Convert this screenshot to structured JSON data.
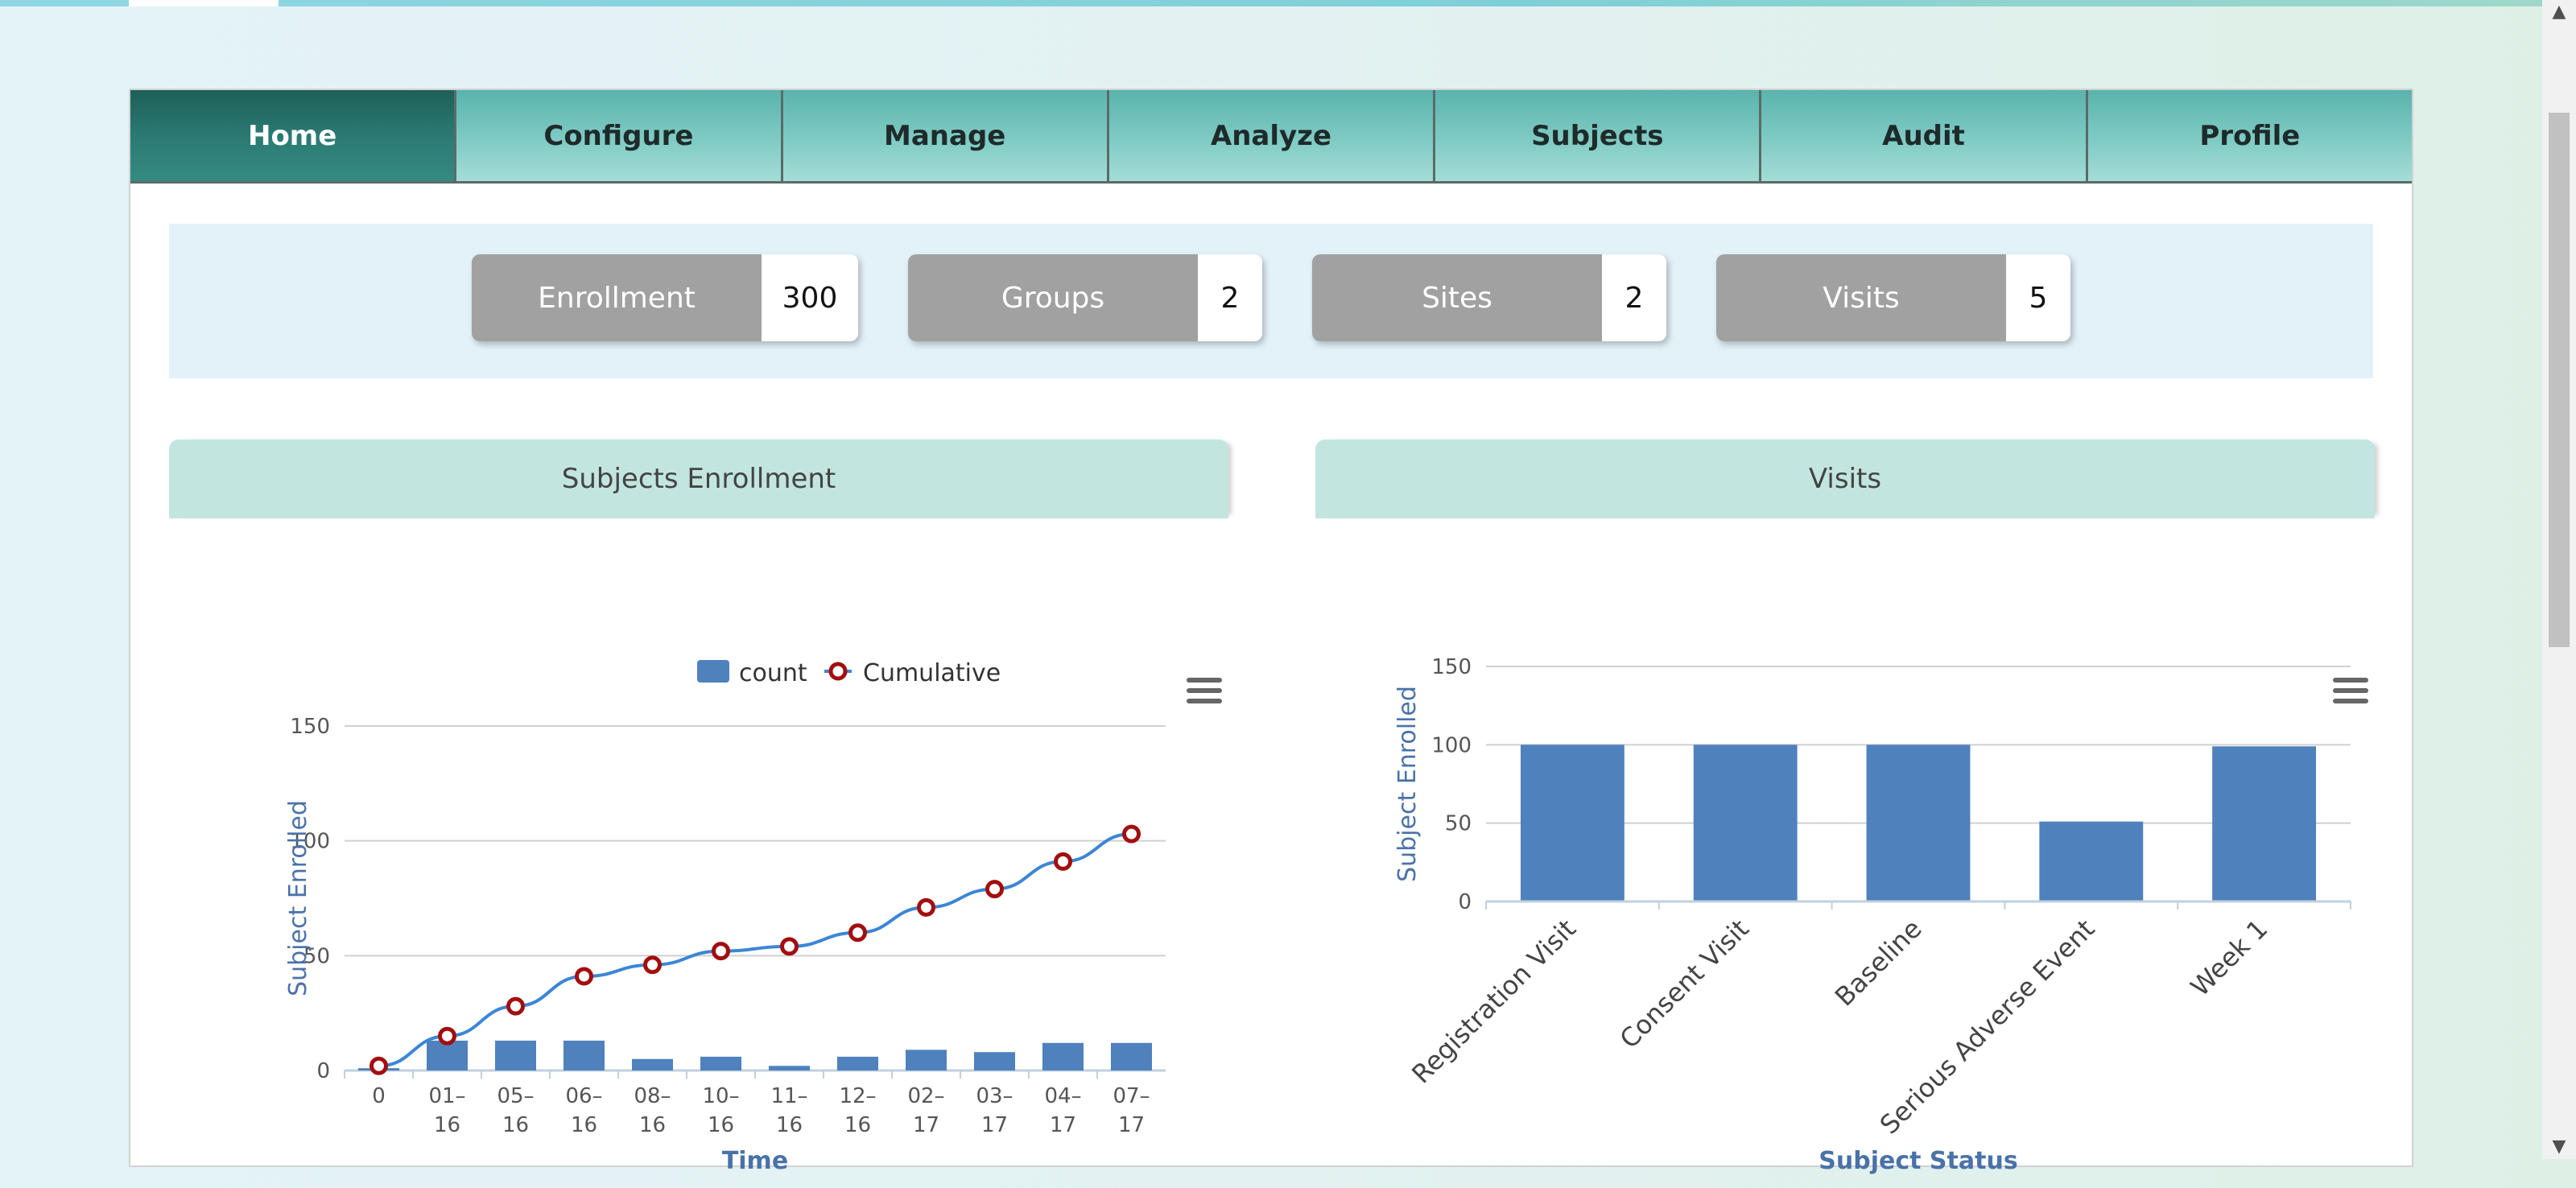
{
  "nav": {
    "tabs": [
      {
        "label": "Home",
        "active": true
      },
      {
        "label": "Configure"
      },
      {
        "label": "Manage"
      },
      {
        "label": "Analyze"
      },
      {
        "label": "Subjects"
      },
      {
        "label": "Audit"
      },
      {
        "label": "Profile"
      }
    ]
  },
  "stats": {
    "enrollment": {
      "label": "Enrollment",
      "value": "300"
    },
    "groups": {
      "label": "Groups",
      "value": "2"
    },
    "sites": {
      "label": "Sites",
      "value": "2"
    },
    "visits": {
      "label": "Visits",
      "value": "5"
    }
  },
  "cards": {
    "enrollment_title": "Subjects Enrollment",
    "visits_title": "Visits"
  },
  "icons": {
    "chart_menu": "hamburger-menu-icon"
  },
  "colors": {
    "bar": "#4f81bd",
    "line": "#3b86d6",
    "marker": "#a20e0e",
    "axis_title": "#4a72a8"
  },
  "chart_data": [
    {
      "type": "bar",
      "title": "",
      "legend": [
        "count",
        "Cumulative"
      ],
      "legend_position": "top-center",
      "categories": [
        "0",
        "01-16",
        "05-16",
        "06-16",
        "08-16",
        "10-16",
        "11-16",
        "12-16",
        "02-17",
        "03-17",
        "04-17",
        "07-17"
      ],
      "series": [
        {
          "name": "count",
          "type": "bar",
          "values": [
            1,
            13,
            13,
            13,
            5,
            6,
            2,
            6,
            9,
            8,
            12,
            12
          ]
        },
        {
          "name": "Cumulative",
          "type": "line",
          "values": [
            2,
            15,
            28,
            41,
            46,
            52,
            54,
            60,
            71,
            79,
            91,
            103
          ]
        }
      ],
      "xlabel": "Time",
      "ylabel": "Subject Enrolled",
      "ylim": [
        0,
        150
      ],
      "yticks": [
        0,
        50,
        100,
        150
      ],
      "grid": true
    },
    {
      "type": "bar",
      "title": "",
      "categories": [
        "Registration Visit",
        "Consent Visit",
        "Baseline",
        "Serious Adverse Event",
        "Week 1"
      ],
      "values": [
        100,
        100,
        100,
        51,
        99
      ],
      "xlabel": "Subject Status",
      "ylabel": "Subject Enrolled",
      "ylim": [
        0,
        150
      ],
      "yticks": [
        0,
        50,
        100,
        150
      ],
      "grid": true
    }
  ]
}
